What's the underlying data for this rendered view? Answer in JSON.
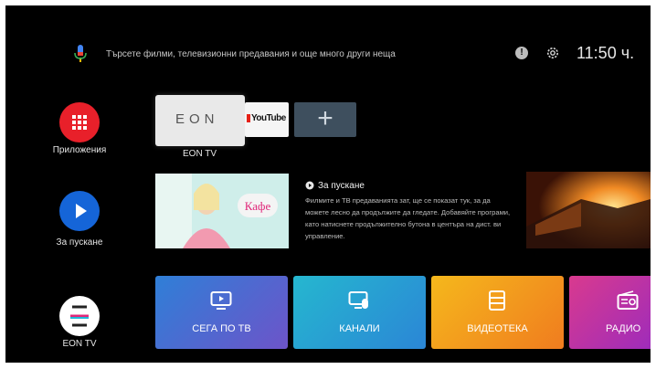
{
  "search": {
    "placeholder": "Търсете филми, телевизионни предавания и още много други неща"
  },
  "status": {
    "clock": "11:50 ч."
  },
  "rail": {
    "apps_label": "Приложения",
    "play_next_label": "За пускане",
    "eon_label": "EON TV"
  },
  "apps_row": {
    "eon_tile_logo": "EON",
    "eon_tile_label": "EON TV",
    "youtube_label": "YouTube",
    "add_label": "+"
  },
  "play_next": {
    "title": "За пускане",
    "description": "Филмите и ТВ предаванията зат, ще се показат тук, за да можете лесно да продължите да гледате. Добавяйте програми, като натиснете продължително бутона в центъра на дист. ви управление.",
    "thumb_logo": "Кафе"
  },
  "channels_row": [
    {
      "label": "СЕГА ПО ТВ",
      "icon": "tv-play-icon"
    },
    {
      "label": "КАНАЛИ",
      "icon": "channels-icon"
    },
    {
      "label": "ВИДЕОТЕКА",
      "icon": "film-icon"
    },
    {
      "label": "РАДИО",
      "icon": "radio-icon"
    }
  ],
  "colors": {
    "apps_button": "#e8202a",
    "play_next_button": "#1565d8",
    "add_tile": "#3e4f5e"
  }
}
